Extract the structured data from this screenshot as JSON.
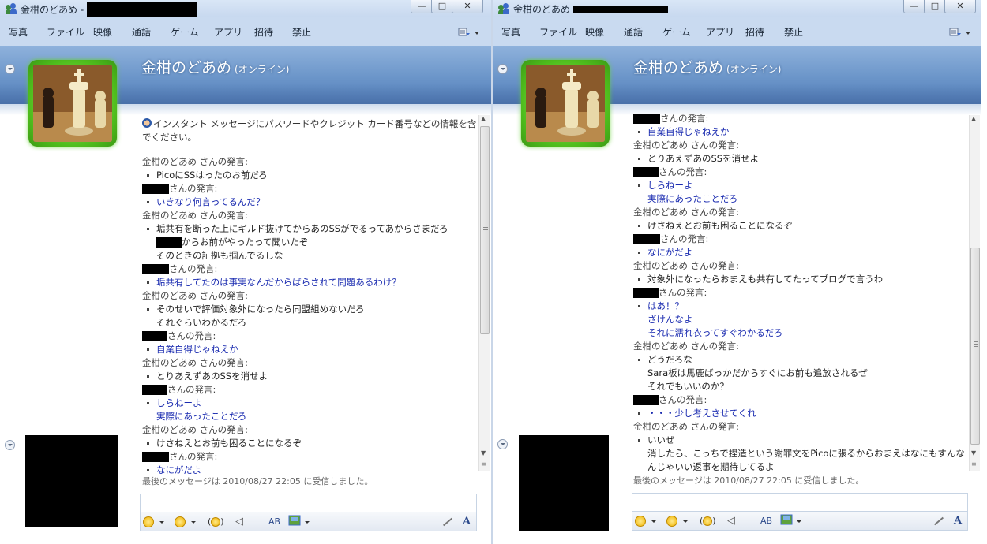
{
  "colors": {
    "accent": "#6b95c9",
    "online_green": "#4fbd1d",
    "other_text": "#1a2bb0"
  },
  "left": {
    "window_title": "金柑のどあめ -",
    "menu": [
      "写真",
      "ファイル",
      "映像",
      "通話",
      "ゲーム",
      "アプリ",
      "招待",
      "禁止"
    ],
    "contact": {
      "name": "金柑のどあめ",
      "status": "(オンライン)"
    },
    "security_notice": [
      "インスタント メッセージにパスワードやクレジット カード番号などの情報を含めない",
      "でください。"
    ],
    "messages": [
      {
        "speaker": "金柑のどあめ さんの発言:",
        "lines": [
          "PicoにSSはったのお前だろ"
        ]
      },
      {
        "speaker": "さんの発言:",
        "other": true,
        "lines": [
          "いきなり何言ってるんだ？"
        ]
      },
      {
        "speaker": "金柑のどあめ さんの発言:",
        "lines": [
          "垢共有を断った上にギルド抜けてからあのSSがでるってあからさまだろ",
          "からお前がやったって聞いたぞ",
          "そのときの証拠も掴んでるしな"
        ]
      },
      {
        "speaker": "さんの発言:",
        "other": true,
        "lines": [
          "垢共有してたのは事実なんだからばらされて問題あるわけ？"
        ]
      },
      {
        "speaker": "金柑のどあめ さんの発言:",
        "lines": [
          "そのせいで評価対象外になったら同盟組めないだろ",
          "それぐらいわかるだろ"
        ]
      },
      {
        "speaker": "さんの発言:",
        "other": true,
        "lines": [
          "自業自得じゃねえか"
        ]
      },
      {
        "speaker": "金柑のどあめ さんの発言:",
        "lines": [
          "とりあえずあのSSを消せよ"
        ]
      },
      {
        "speaker": "さんの発言:",
        "other": true,
        "lines": [
          "しらねーよ",
          "実際にあったことだろ"
        ]
      },
      {
        "speaker": "金柑のどあめ さんの発言:",
        "lines": [
          "けさねえとお前も困ることになるぞ"
        ]
      },
      {
        "speaker": "さんの発言:",
        "other": true,
        "lines": [
          "なにがだよ"
        ]
      }
    ],
    "last_message": "最後のメッセージは 2010/08/27 22:05 に受信しました。"
  },
  "right": {
    "window_title": "金柑のどあめ",
    "menu": [
      "写真",
      "ファイル",
      "映像",
      "通話",
      "ゲーム",
      "アプリ",
      "招待",
      "禁止"
    ],
    "contact": {
      "name": "金柑のどあめ",
      "status": "(オンライン)"
    },
    "messages": [
      {
        "speaker": "さんの発言:",
        "other": true,
        "lines": [
          "自業自得じゃねえか"
        ]
      },
      {
        "speaker": "金柑のどあめ さんの発言:",
        "lines": [
          "とりあえずあのSSを消せよ"
        ]
      },
      {
        "speaker": "さんの発言:",
        "other": true,
        "lines": [
          "しらねーよ",
          "実際にあったことだろ"
        ]
      },
      {
        "speaker": "金柑のどあめ さんの発言:",
        "lines": [
          "けさねえとお前も困ることになるぞ"
        ]
      },
      {
        "speaker": "さんの発言:",
        "other": true,
        "lines": [
          "なにがだよ"
        ]
      },
      {
        "speaker": "金柑のどあめ さんの発言:",
        "lines": [
          "対象外になったらおまえも共有してたってブログで言うわ"
        ]
      },
      {
        "speaker": "さんの発言:",
        "other": true,
        "lines": [
          "はあ！？",
          "ざけんなよ",
          "それに濡れ衣ってすぐわかるだろ"
        ]
      },
      {
        "speaker": "金柑のどあめ さんの発言:",
        "lines": [
          "どうだろな",
          "Sara板は馬鹿ばっかだからすぐにお前も追放されるぜ",
          "それでもいいのか？"
        ]
      },
      {
        "speaker": "さんの発言:",
        "other": true,
        "lines": [
          "・・・少し考えさせてくれ"
        ]
      },
      {
        "speaker": "金柑のどあめ さんの発言:",
        "lines": [
          "いいぜ",
          "消したら、こっちで捏造という謝罪文をPicoに張るからおまえはなにもすんな",
          "んじゃいい返事を期待してるよ"
        ]
      }
    ],
    "last_message": "最後のメッセージは 2010/08/27 22:05 に受信しました。"
  }
}
